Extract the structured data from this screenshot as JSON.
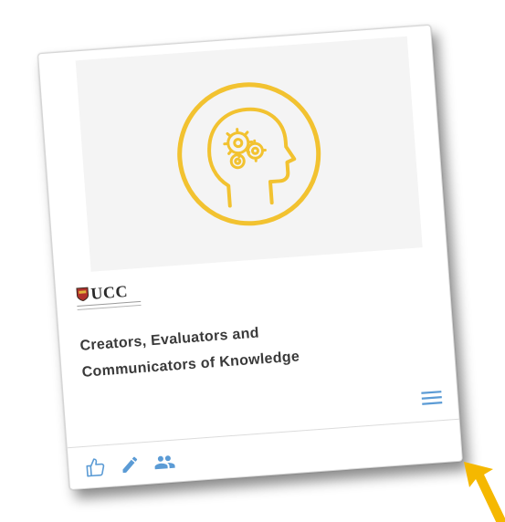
{
  "card": {
    "logo_text": "UCC",
    "title_line1": "Creators, Evaluators and",
    "title_line2": "Communicators of Knowledge",
    "image_icon": "head-with-gears-icon",
    "menu_icon": "hamburger-menu-icon",
    "actions": [
      {
        "icon": "thumbs-up-icon"
      },
      {
        "icon": "pencil-icon"
      },
      {
        "icon": "people-icon"
      }
    ]
  },
  "colors": {
    "accent_yellow": "#f2c230",
    "icon_blue": "#5b9bd5",
    "arrow_yellow": "#f5b800"
  }
}
